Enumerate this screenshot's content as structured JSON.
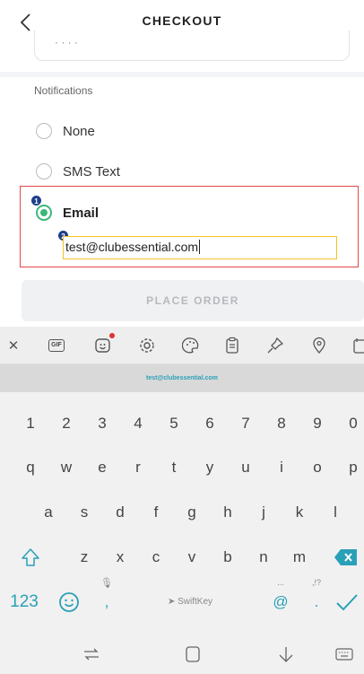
{
  "header": {
    "title": "CHECKOUT",
    "back_icon": "chevron-left-icon"
  },
  "prev_card": {
    "partial_text": "·   ·   ·   ·"
  },
  "notifications": {
    "label": "Notifications",
    "options": [
      {
        "label": "None",
        "selected": false
      },
      {
        "label": "SMS Text",
        "selected": false
      },
      {
        "label": "Email",
        "selected": true
      }
    ],
    "email_value": "test@clubessential.com",
    "annotation_badges": [
      "1",
      "2"
    ],
    "highlight_color": "#e04848",
    "accent_color": "#3cb77a"
  },
  "place_order": {
    "label": "PLACE ORDER"
  },
  "keyboard": {
    "toolbar_icons": [
      "close-icon",
      "gif-icon",
      "sticker-icon",
      "settings-icon",
      "theme-palette-icon",
      "clipboard-icon",
      "pin-icon",
      "location-icon",
      "calendar-icon"
    ],
    "gif_label": "GIF",
    "suggestion": "test@clubessential.com",
    "row_numbers": [
      "1",
      "2",
      "3",
      "4",
      "5",
      "6",
      "7",
      "8",
      "9",
      "0"
    ],
    "row1": [
      "q",
      "w",
      "e",
      "r",
      "t",
      "y",
      "u",
      "i",
      "o",
      "p"
    ],
    "row2": [
      "a",
      "s",
      "d",
      "f",
      "g",
      "h",
      "j",
      "k",
      "l"
    ],
    "row3": [
      "z",
      "x",
      "c",
      "v",
      "b",
      "n",
      "m"
    ],
    "numbers_key": "123",
    "space_label": "SwiftKey",
    "at_key": "@",
    "period_key": ".",
    "comma_key": ",",
    "period_sub": ",!?",
    "at_sub": "..."
  }
}
